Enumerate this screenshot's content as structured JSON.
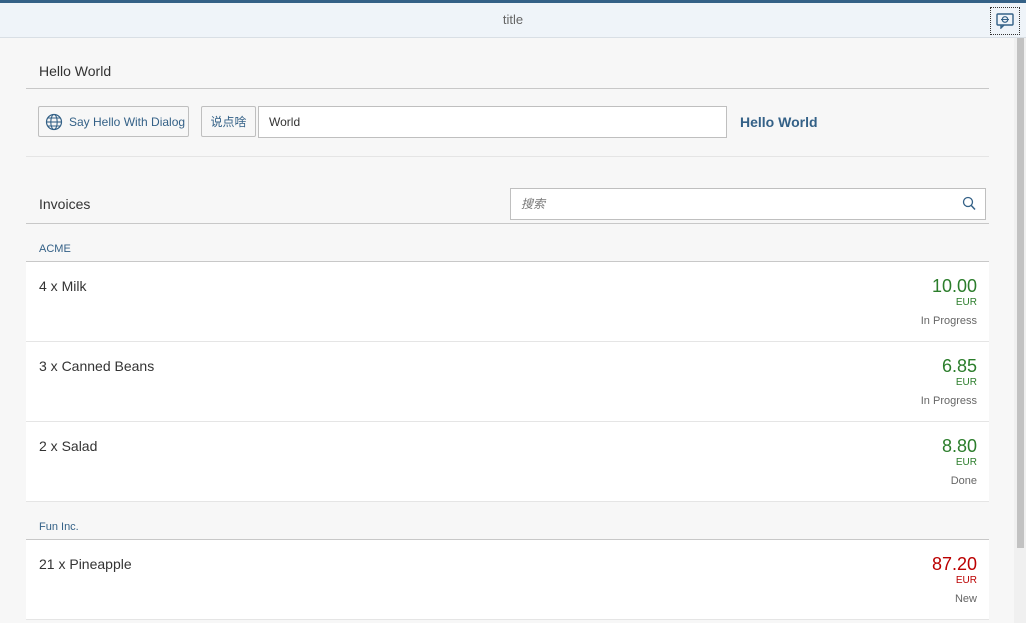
{
  "header": {
    "title": "title"
  },
  "hello_panel": {
    "title": "Hello World",
    "dialog_button_label": "Say Hello With Dialog",
    "say_button_label": "说点啥",
    "name_input_value": "World",
    "output_text": "Hello World"
  },
  "invoices": {
    "title": "Invoices",
    "search_placeholder": "搜索",
    "groups": [
      {
        "name": "ACME",
        "items": [
          {
            "title": "4 x Milk",
            "amount": "10.00",
            "currency": "EUR",
            "status": "In Progress",
            "state": "success"
          },
          {
            "title": "3 x Canned Beans",
            "amount": "6.85",
            "currency": "EUR",
            "status": "In Progress",
            "state": "success"
          },
          {
            "title": "2 x Salad",
            "amount": "8.80",
            "currency": "EUR",
            "status": "Done",
            "state": "success"
          }
        ]
      },
      {
        "name": "Fun Inc.",
        "items": [
          {
            "title": "21 x Pineapple",
            "amount": "87.20",
            "currency": "EUR",
            "status": "New",
            "state": "error"
          }
        ]
      }
    ]
  },
  "colors": {
    "accent": "#346187",
    "success": "#2b7d2b",
    "error": "#bb0000"
  }
}
